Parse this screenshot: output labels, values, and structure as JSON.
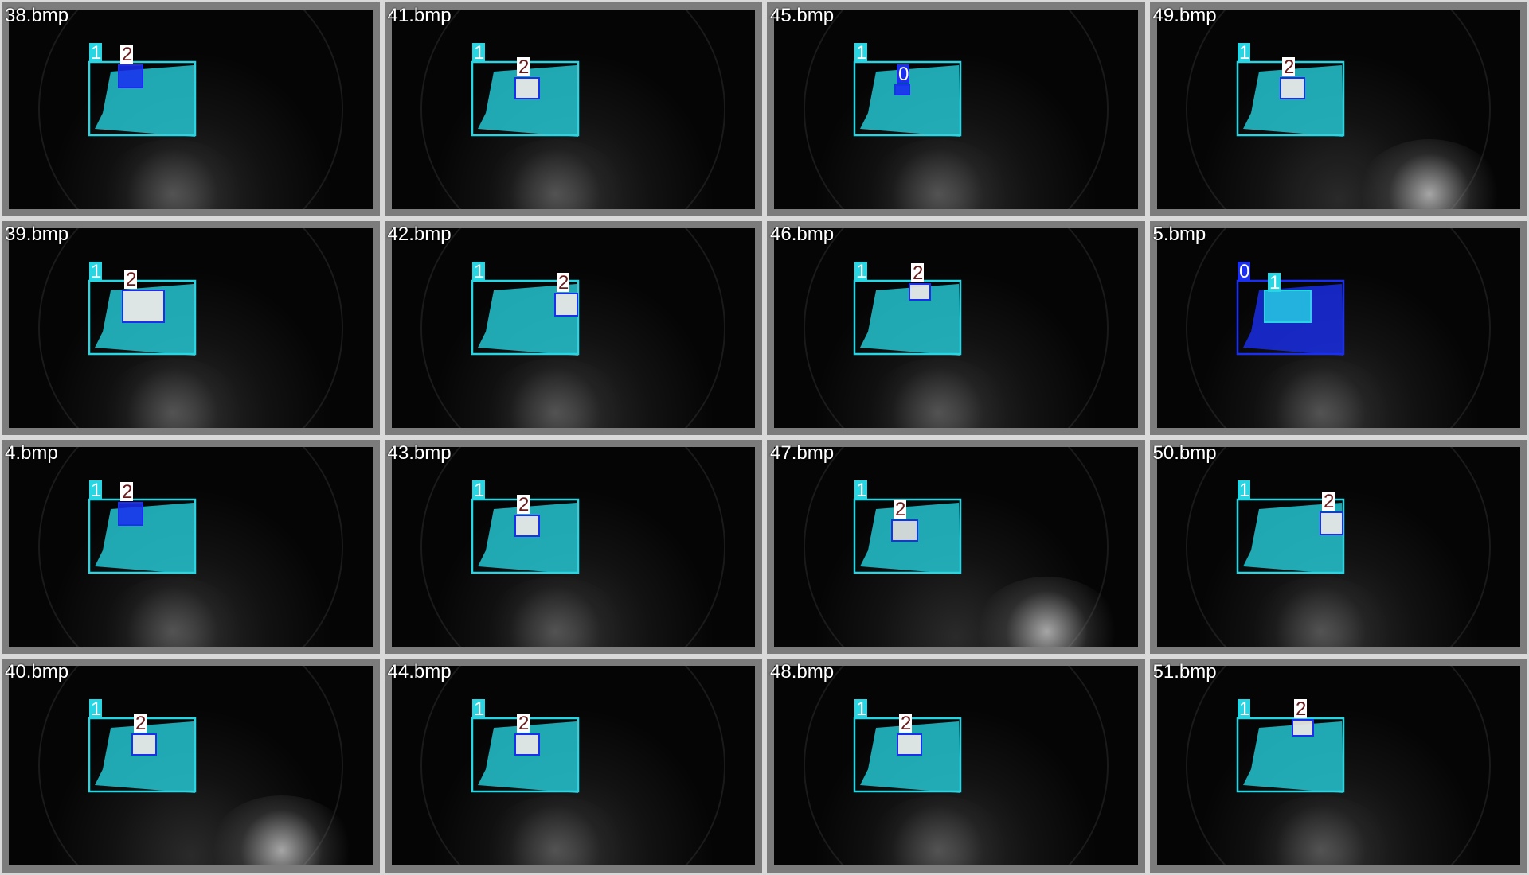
{
  "colors": {
    "class_0": "#1a2ff0",
    "class_1": "#27d5e3",
    "class_2": "#ffffff",
    "class_2_text": "#6a1a1a",
    "class_0_text": "#ffffff",
    "class_1_text": "#ffffff"
  },
  "tiles": [
    {
      "filename": "38.bmp",
      "labels": [
        {
          "class": "1",
          "text": "1"
        },
        {
          "class": "2",
          "text": "2"
        }
      ],
      "box2": "blue",
      "glow": "normal"
    },
    {
      "filename": "41.bmp",
      "labels": [
        {
          "class": "1",
          "text": "1"
        },
        {
          "class": "2",
          "text": "2"
        }
      ],
      "box2": "white",
      "glow": "normal"
    },
    {
      "filename": "45.bmp",
      "labels": [
        {
          "class": "1",
          "text": "1"
        },
        {
          "class": "0",
          "text": "0"
        }
      ],
      "box2": "small",
      "glow": "normal"
    },
    {
      "filename": "49.bmp",
      "labels": [
        {
          "class": "1",
          "text": "1"
        },
        {
          "class": "2",
          "text": "2"
        }
      ],
      "box2": "white",
      "glow": "bright"
    },
    {
      "filename": "39.bmp",
      "labels": [
        {
          "class": "1",
          "text": "1"
        },
        {
          "class": "2",
          "text": "2"
        }
      ],
      "box2": "large",
      "glow": "normal"
    },
    {
      "filename": "42.bmp",
      "labels": [
        {
          "class": "1",
          "text": "1"
        },
        {
          "class": "2",
          "text": "2"
        }
      ],
      "box2": "right",
      "glow": "normal"
    },
    {
      "filename": "46.bmp",
      "labels": [
        {
          "class": "1",
          "text": "1"
        },
        {
          "class": "2",
          "text": "2"
        }
      ],
      "box2": "top",
      "glow": "normal"
    },
    {
      "filename": "5.bmp",
      "labels": [
        {
          "class": "0",
          "text": "0"
        },
        {
          "class": "1",
          "text": "1"
        }
      ],
      "box2": "blue-board",
      "glow": "normal"
    },
    {
      "filename": "4.bmp",
      "labels": [
        {
          "class": "1",
          "text": "1"
        },
        {
          "class": "2",
          "text": "2"
        }
      ],
      "box2": "blue",
      "glow": "normal"
    },
    {
      "filename": "43.bmp",
      "labels": [
        {
          "class": "1",
          "text": "1"
        },
        {
          "class": "2",
          "text": "2"
        }
      ],
      "box2": "white",
      "glow": "normal"
    },
    {
      "filename": "47.bmp",
      "labels": [
        {
          "class": "1",
          "text": "1"
        },
        {
          "class": "2",
          "text": "2"
        }
      ],
      "box2": "white-low",
      "glow": "bright"
    },
    {
      "filename": "50.bmp",
      "labels": [
        {
          "class": "1",
          "text": "1"
        },
        {
          "class": "2",
          "text": "2"
        }
      ],
      "box2": "right",
      "glow": "normal"
    },
    {
      "filename": "40.bmp",
      "labels": [
        {
          "class": "1",
          "text": "1"
        },
        {
          "class": "2",
          "text": "2"
        }
      ],
      "box2": "white",
      "glow": "bright"
    },
    {
      "filename": "44.bmp",
      "labels": [
        {
          "class": "1",
          "text": "1"
        },
        {
          "class": "2",
          "text": "2"
        }
      ],
      "box2": "white",
      "glow": "normal"
    },
    {
      "filename": "48.bmp",
      "labels": [
        {
          "class": "1",
          "text": "1"
        },
        {
          "class": "2",
          "text": "2"
        }
      ],
      "box2": "white",
      "glow": "normal"
    },
    {
      "filename": "51.bmp",
      "labels": [
        {
          "class": "1",
          "text": "1"
        },
        {
          "class": "2",
          "text": "2"
        }
      ],
      "box2": "top-right",
      "glow": "normal"
    }
  ]
}
